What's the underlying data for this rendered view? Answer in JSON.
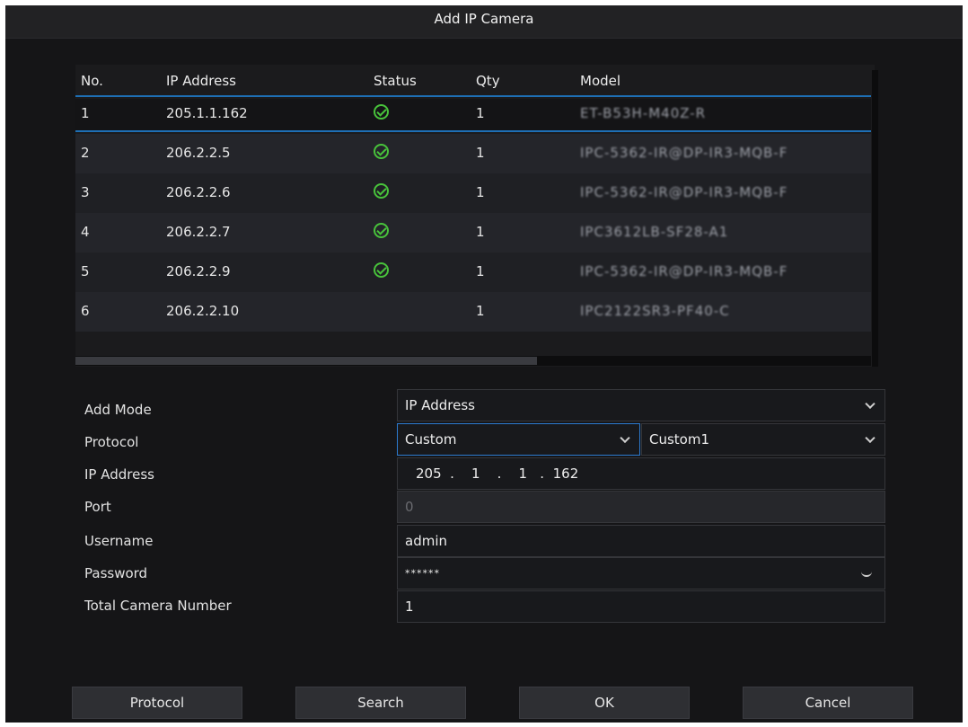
{
  "dialog": {
    "title": "Add IP Camera"
  },
  "table": {
    "headers": {
      "no": "No.",
      "ip": "IP Address",
      "status": "Status",
      "qty": "Qty",
      "model": "Model"
    },
    "rows": [
      {
        "no": "1",
        "ip": "205.1.1.162",
        "status": "online",
        "qty": "1",
        "model": "ET-B53H-M40Z-R"
      },
      {
        "no": "2",
        "ip": "206.2.2.5",
        "status": "online",
        "qty": "1",
        "model": "IPC-5362-IR@DP-IR3-MQB-F"
      },
      {
        "no": "3",
        "ip": "206.2.2.6",
        "status": "online",
        "qty": "1",
        "model": "IPC-5362-IR@DP-IR3-MQB-F"
      },
      {
        "no": "4",
        "ip": "206.2.2.7",
        "status": "online",
        "qty": "1",
        "model": "IPC3612LB-SF28-A1"
      },
      {
        "no": "5",
        "ip": "206.2.2.9",
        "status": "online",
        "qty": "1",
        "model": "IPC-5362-IR@DP-IR3-MQB-F"
      },
      {
        "no": "6",
        "ip": "206.2.2.10",
        "status": "",
        "qty": "1",
        "model": "IPC2122SR3-PF40-C"
      }
    ]
  },
  "form": {
    "add_mode": {
      "label": "Add Mode",
      "value": "IP Address"
    },
    "protocol": {
      "label": "Protocol",
      "value": "Custom",
      "custom_value": "Custom1"
    },
    "ip_address": {
      "label": "IP Address",
      "value": "205  .    1    .    1   .  162"
    },
    "port": {
      "label": "Port",
      "value": "0"
    },
    "username": {
      "label": "Username",
      "value": "admin"
    },
    "password": {
      "label": "Password",
      "value": "******"
    },
    "total_camera_number": {
      "label": "Total Camera Number",
      "value": "1"
    }
  },
  "buttons": {
    "protocol": "Protocol",
    "search": "Search",
    "ok": "OK",
    "cancel": "Cancel"
  },
  "colors": {
    "accent": "#1e6fb5",
    "online": "#48c23b",
    "background": "#151517"
  }
}
